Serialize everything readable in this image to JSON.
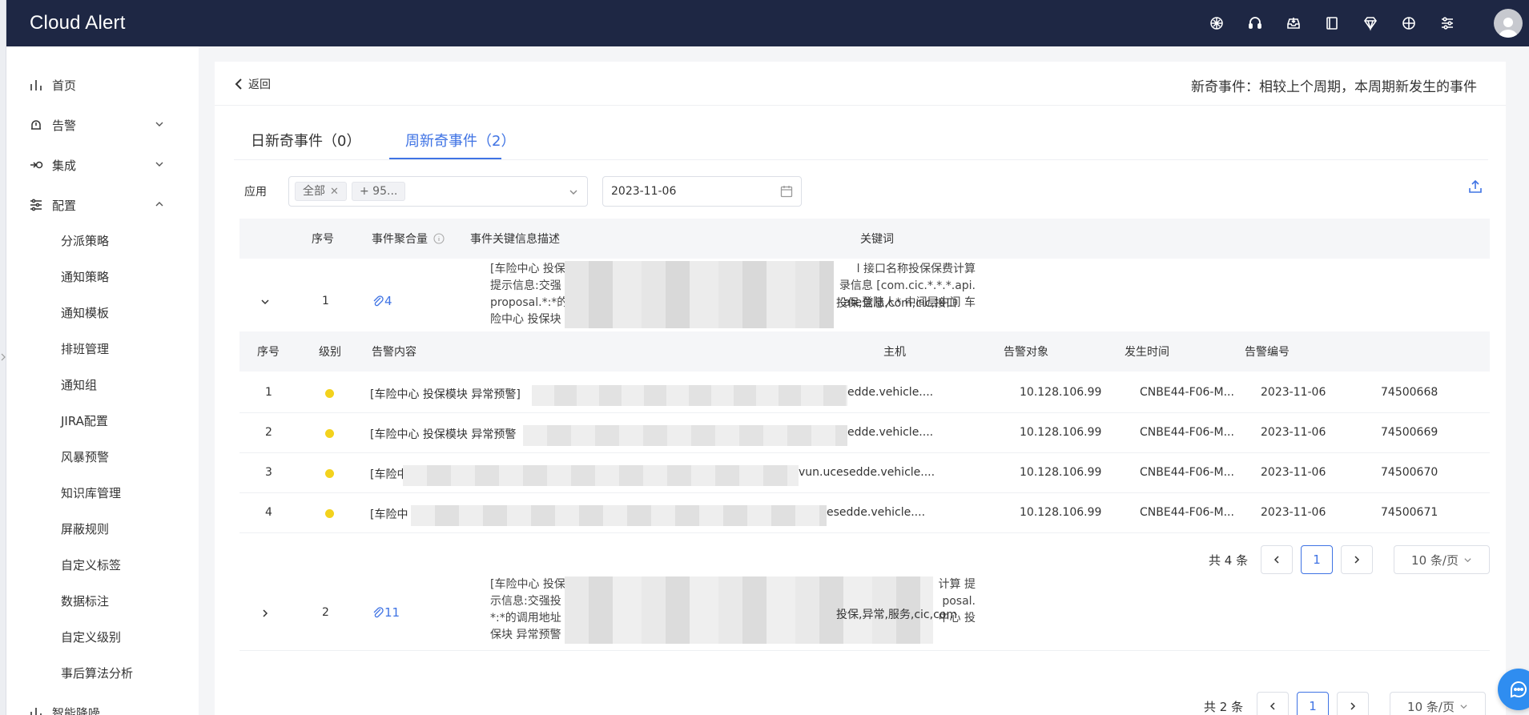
{
  "app": {
    "title": "Cloud Alert"
  },
  "topbar": {
    "icons": [
      "openai-icon",
      "headset-icon",
      "inbox-icon",
      "book-icon",
      "diamond-icon",
      "globe-icon",
      "sliders-icon"
    ]
  },
  "sidebar": {
    "items": [
      {
        "label": "首页",
        "icon": "bar-chart-icon"
      },
      {
        "label": "告警",
        "icon": "alarm-icon",
        "expanded": false
      },
      {
        "label": "集成",
        "icon": "integration-icon",
        "expanded": false
      },
      {
        "label": "配置",
        "icon": "settings-sliders-icon",
        "expanded": true
      }
    ],
    "config_sub": [
      "分派策略",
      "通知策略",
      "通知模板",
      "排班管理",
      "通知组",
      "JIRA配置",
      "风暴预警",
      "知识库管理",
      "屏蔽规则",
      "自定义标签",
      "数据标注",
      "自定义级别",
      "事后算法分析"
    ],
    "next_item": "智能降噪"
  },
  "page": {
    "back_label": "返回",
    "hint": "新奇事件：相较上个周期，本周期新发生的事件",
    "tabs": [
      {
        "label": "日新奇事件（0）",
        "active": false
      },
      {
        "label": "周新奇事件（2）",
        "active": true
      }
    ],
    "filter": {
      "app_label": "应用",
      "tags": [
        "全部",
        "+ 95..."
      ],
      "date": "2023-11-06"
    }
  },
  "events_table": {
    "columns": [
      "序号",
      "事件聚合量",
      "事件关键信息描述",
      "关键词"
    ],
    "rows": [
      {
        "index": "1",
        "count": "4",
        "desc_lines": [
          "[车险中心 投保",
          "提示信息:交强",
          "proposal.*:*的",
          "险中心 投保块"
        ],
        "desc_right_lines": [
          "l 接口名称投保保费计算",
          "录信息 [com.cic.*.*.*.api.",
          "ate登陆人* 中间层中间 车",
          ""
        ],
        "keywords": "投保,信息,com,cic,接口",
        "expanded": true
      },
      {
        "index": "2",
        "count": "11",
        "desc_lines": [
          "[车险中心 投保",
          "示信息:交强投",
          "*:*的调用地址",
          "保块 异常预警"
        ],
        "desc_right_lines": [
          "计算 提",
          "posal.",
          "中心 投",
          ""
        ],
        "keywords": "投保,异常,服务,cic,com",
        "expanded": false
      }
    ],
    "total": "共 2 条",
    "page": "1",
    "page_size": "10 条/页"
  },
  "alerts_table": {
    "columns": [
      "序号",
      "级别",
      "告警内容",
      "主机",
      "告警对象",
      "发生时间",
      "告警编号"
    ],
    "rows": [
      {
        "index": "1",
        "content_left": "[车险中心 投保模块 异常预警]",
        "content_right": "edde.vehicle....",
        "host": "10.128.106.99",
        "target": "CNBE44-F06-M...",
        "time": "2023-11-06",
        "id": "74500668"
      },
      {
        "index": "2",
        "content_left": "[车险中心 投保模块 异常预警",
        "content_right": "edde.vehicle....",
        "host": "10.128.106.99",
        "target": "CNBE44-F06-M...",
        "time": "2023-11-06",
        "id": "74500669"
      },
      {
        "index": "3",
        "content_left": "[车险中",
        "content_right": "vun.ucesedde.vehicle....",
        "host": "10.128.106.99",
        "target": "CNBE44-F06-M...",
        "time": "2023-11-06",
        "id": "74500670"
      },
      {
        "index": "4",
        "content_left": "[车险中",
        "content_right": "esedde.vehicle....",
        "host": "10.128.106.99",
        "target": "CNBE44-F06-M...",
        "time": "2023-11-06",
        "id": "74500671"
      }
    ],
    "total": "共 4 条",
    "page": "1",
    "page_size": "10 条/页",
    "level_color": "#f3d21d"
  },
  "colors": {
    "primary": "#3f73e4",
    "topbar": "#1e2744",
    "fab": "#2f8df0"
  }
}
